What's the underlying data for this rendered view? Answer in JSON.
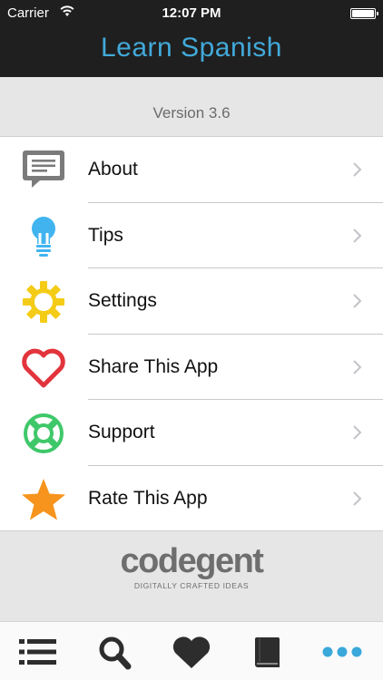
{
  "status_bar": {
    "carrier": "Carrier",
    "time": "12:07 PM"
  },
  "nav": {
    "title": "Learn Spanish"
  },
  "version": {
    "text": "Version 3.6"
  },
  "menu": {
    "items": [
      {
        "label": "About",
        "icon": "speech-bubble-icon",
        "color": "#7b7b7b"
      },
      {
        "label": "Tips",
        "icon": "lightbulb-icon",
        "color": "#41b4f0"
      },
      {
        "label": "Settings",
        "icon": "gear-icon",
        "color": "#f4cc17"
      },
      {
        "label": "Share This App",
        "icon": "heart-outline-icon",
        "color": "#e2343c"
      },
      {
        "label": "Support",
        "icon": "lifebuoy-icon",
        "color": "#3fc86a"
      },
      {
        "label": "Rate This App",
        "icon": "star-icon",
        "color": "#f7941d"
      }
    ]
  },
  "footer": {
    "logo": "codegent",
    "tagline": "DIGITALLY CRAFTED IDEAS"
  },
  "tabbar": {
    "tabs": [
      {
        "icon": "list-icon",
        "active": false
      },
      {
        "icon": "search-icon",
        "active": false
      },
      {
        "icon": "heart-icon",
        "active": false
      },
      {
        "icon": "book-icon",
        "active": false
      },
      {
        "icon": "more-icon",
        "active": true
      }
    ],
    "active_color": "#3aa8db",
    "inactive_color": "#2d2d2d"
  }
}
